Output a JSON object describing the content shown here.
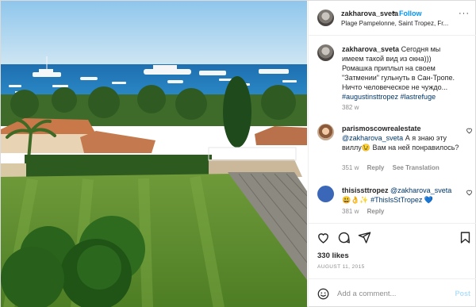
{
  "post": {
    "username": "zakharova_sveta",
    "follow_label": "Follow",
    "separator": "•",
    "location": "Plage Pampelonne, Saint Tropez, Fr..."
  },
  "caption": {
    "username": "zakharova_sveta",
    "text": "Сегодня мы имеем такой вид из окна))) Ромашка приплыл на своем \"Затмении\" гульнуть в Сан-Тропе. Ничто человеческое не чуждо...",
    "hashtags": "#augustinsttropez #lastrefuge",
    "time": "382 w"
  },
  "comments": [
    {
      "username": "parismoscowrealestate",
      "mention": "@zakharova_sveta",
      "text": "А я знаю эту виллу😉 Вам на ней понравилось?",
      "time": "351 w",
      "reply_label": "Reply",
      "translate_label": "See Translation"
    },
    {
      "username": "thisissttropez",
      "mention": "@zakharova_sveta",
      "text": "😃👌✨",
      "hashtag": "#ThisIsStTropez 💙",
      "time": "381 w",
      "reply_label": "Reply"
    }
  ],
  "actions": {
    "icons": [
      "heart-icon",
      "comment-icon",
      "share-icon",
      "bookmark-icon"
    ]
  },
  "likes": "330 likes",
  "date": "AUGUST 11, 2015",
  "composer": {
    "placeholder": "Add a comment...",
    "post_label": "Post"
  },
  "colors": {
    "link": "#0095f6",
    "hashtag": "#00376b",
    "muted": "#8e8e8e",
    "post_disabled": "#b2dffc"
  }
}
